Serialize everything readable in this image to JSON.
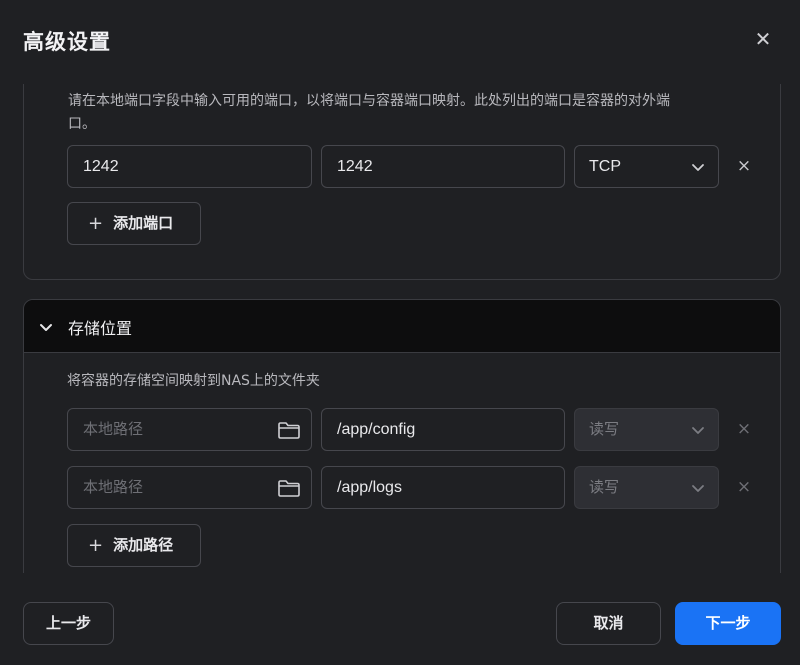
{
  "dialog": {
    "title": "高级设置",
    "close_icon": "close-icon"
  },
  "ports": {
    "hint_line1": "请在本地端口字段中输入可用的端口，以将端口与容器端口映射。此处列出的端口是容器的对外端",
    "hint_line2": "口。",
    "rows": [
      {
        "local_port": "1242",
        "container_port": "1242",
        "protocol": "TCP",
        "remove": "×"
      }
    ],
    "add_label": "添加端口",
    "add_icon": "+"
  },
  "storage": {
    "section_title": "存储位置",
    "hint": "将容器的存储空间映射到NAS上的文件夹",
    "rows": [
      {
        "local_placeholder": "本地路径",
        "container_path": "/app/config",
        "mode": "读写",
        "remove": "×"
      },
      {
        "local_placeholder": "本地路径",
        "container_path": "/app/logs",
        "mode": "读写",
        "remove": "×"
      }
    ],
    "add_label": "添加路径",
    "add_icon": "+"
  },
  "footer": {
    "prev_label": "上一步",
    "cancel_label": "取消",
    "next_label": "下一步"
  },
  "colors": {
    "background": "#1f2023",
    "section_header": "#0d0d0e",
    "primary": "#1a73f5",
    "border": "#46474d"
  }
}
